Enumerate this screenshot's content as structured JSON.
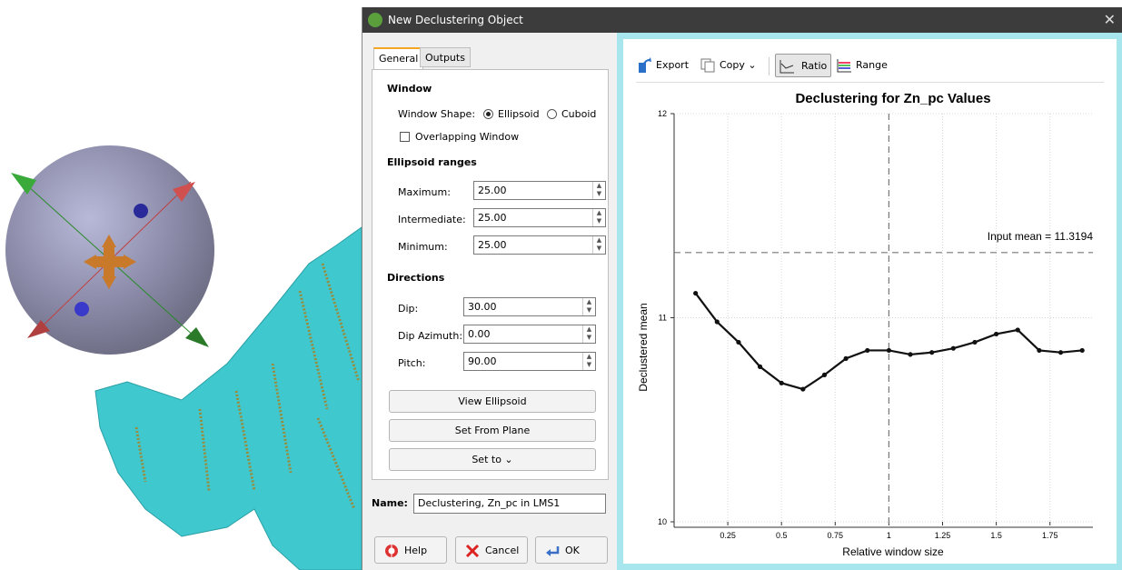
{
  "window": {
    "title": "New Declustering Object",
    "close_glyph": "✕"
  },
  "tabs": [
    {
      "label": "General",
      "active": true
    },
    {
      "label": "Outputs",
      "active": false
    }
  ],
  "general": {
    "window_section": "Window",
    "window_shape_label": "Window Shape:",
    "shape_options": [
      {
        "label": "Ellipsoid",
        "selected": true
      },
      {
        "label": "Cuboid",
        "selected": false
      }
    ],
    "overlapping_label": "Overlapping Window",
    "overlapping_checked": false,
    "ranges_section": "Ellipsoid ranges",
    "ranges": [
      {
        "label": "Maximum:",
        "value": "25.00"
      },
      {
        "label": "Intermediate:",
        "value": "25.00"
      },
      {
        "label": "Minimum:",
        "value": "25.00"
      }
    ],
    "directions_section": "Directions",
    "directions": [
      {
        "label": "Dip:",
        "value": "30.00"
      },
      {
        "label": "Dip Azimuth:",
        "value": "0.00"
      },
      {
        "label": "Pitch:",
        "value": "90.00"
      }
    ],
    "view_ellipsoid_label": "View Ellipsoid",
    "set_from_plane_label": "Set From Plane",
    "set_to_label": "Set to ⌄"
  },
  "name": {
    "label": "Name:",
    "value": "Declustering, Zn_pc in LMS1"
  },
  "buttons": {
    "help": "Help",
    "cancel": "Cancel",
    "ok": "OK"
  },
  "toolbar": {
    "export": "Export",
    "copy": "Copy ⌄",
    "ratio": "Ratio",
    "range": "Range"
  },
  "chart_data": {
    "type": "line",
    "title": "Declustering for Zn_pc Values",
    "xlabel": "Relative window size",
    "ylabel": "Declustered mean",
    "x_ticks": [
      "0.25",
      "0.5",
      "0.75",
      "1",
      "1.25",
      "1.5",
      "1.75"
    ],
    "y_ticks": [
      "10",
      "11",
      "12"
    ],
    "xlim": [
      0,
      1.95
    ],
    "ylim": [
      10,
      12
    ],
    "input_mean": 11.3194,
    "input_mean_label": "Input mean = 11.3194",
    "vertical_marker_x": 1,
    "grid": true,
    "series": [
      {
        "x": [
          0.1,
          0.2,
          0.3,
          0.4,
          0.5,
          0.6,
          0.7,
          0.8,
          0.9,
          1.0,
          1.1,
          1.2,
          1.3,
          1.4,
          1.5,
          1.6,
          1.7,
          1.8,
          1.9
        ],
        "y": [
          11.12,
          10.98,
          10.88,
          10.76,
          10.68,
          10.65,
          10.72,
          10.8,
          10.84,
          10.84,
          10.82,
          10.83,
          10.85,
          10.88,
          10.92,
          10.94,
          10.84,
          10.83,
          10.84
        ]
      }
    ]
  }
}
